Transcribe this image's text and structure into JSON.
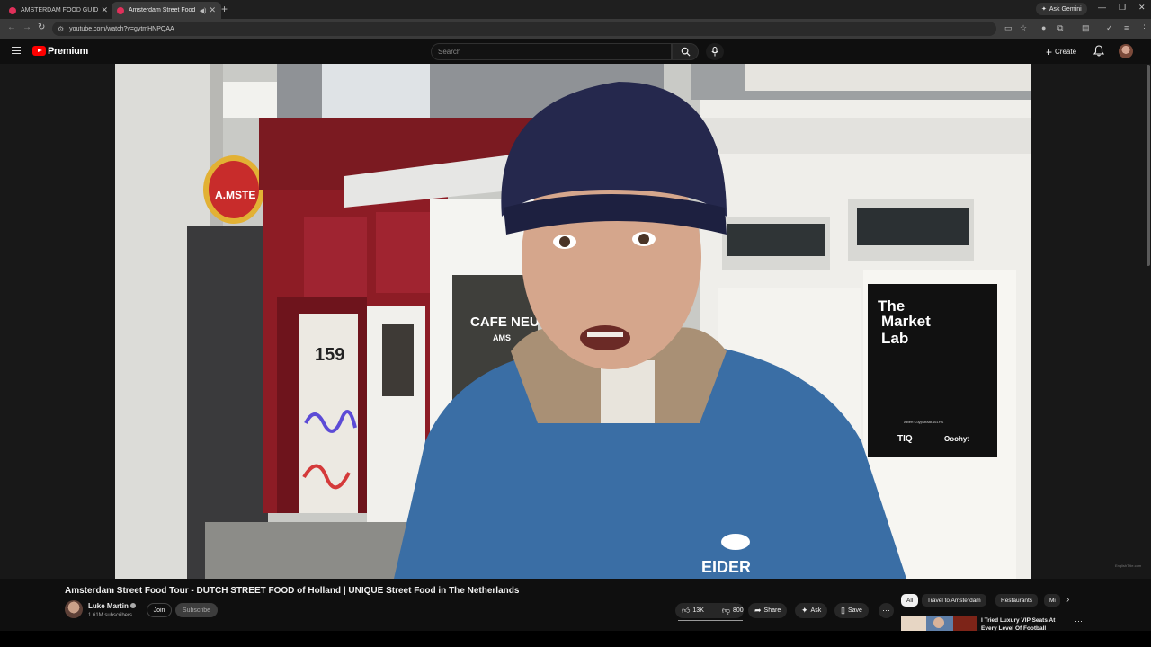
{
  "browser": {
    "tabs": [
      {
        "title": "AMSTERDAM FOOD GUIDE | U",
        "active": false
      },
      {
        "title": "Amsterdam Street Food To",
        "active": true
      }
    ],
    "new_tab": "+",
    "gemini": "Ask Gemini",
    "url": "youtube.com/watch?v=gytmHNPQAA"
  },
  "youtube": {
    "logo_text": "Premium",
    "search_placeholder": "Search",
    "create_label": "Create"
  },
  "video": {
    "title": "Amsterdam Street Food Tour - DUTCH STREET FOOD of Holland | UNIQUE Street Food in The Netherlands",
    "channel": "Luke Martin",
    "subscribers": "1.61M subscribers",
    "join_label": "Join",
    "subscribe_label": "Subscribe",
    "likes": "13K",
    "dislikes": "800",
    "share_label": "Share",
    "ask_label": "Ask",
    "save_label": "Save",
    "more_label": "⋯",
    "watermark": "EnglishTitle.com",
    "scene": {
      "address_number": "159",
      "shop_sign": "CAFE NEU",
      "shop_sub": "AMS",
      "poster_line1": "The",
      "poster_line2": "Market",
      "poster_line3": "Lab",
      "poster_address": "Albert Cuypstraat 161HS",
      "poster_brand1": "TIQ",
      "poster_brand2": "Ooohyt",
      "jacket_brand": "EIDER",
      "bar_sign": "A.MSTE"
    }
  },
  "chips": [
    "All",
    "Travel to Amsterdam",
    "Restaurants",
    "Mi"
  ],
  "recommendation": {
    "title": "I Tried Luxury VIP Seats At Every Level Of Football"
  },
  "colors": {
    "background": "#0f0f0f",
    "accent_red": "#ff0000",
    "jacket_blue": "#3a6ea5",
    "beanie_navy": "#25284d",
    "storefront_red": "#8d1c25"
  }
}
